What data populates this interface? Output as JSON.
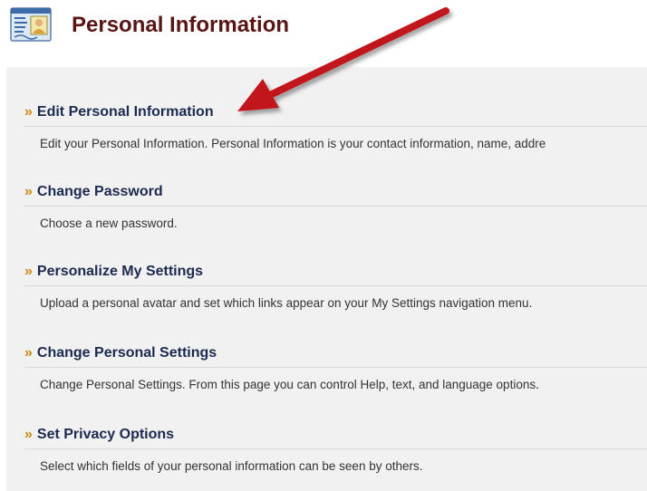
{
  "header": {
    "title": "Personal Information",
    "icon": "personal-info-card-icon"
  },
  "sections": [
    {
      "title": "Edit Personal Information",
      "description": "Edit your Personal Information. Personal Information is your contact information, name, addre"
    },
    {
      "title": "Change Password",
      "description": "Choose a new password."
    },
    {
      "title": "Personalize My Settings",
      "description": "Upload a personal avatar and set which links appear on your My Settings navigation menu."
    },
    {
      "title": "Change Personal Settings",
      "description": "Change Personal Settings. From this page you can control Help, text, and language options."
    },
    {
      "title": "Set Privacy Options",
      "description": "Select which fields of your personal information can be seen by others."
    }
  ],
  "chevron": "»",
  "colors": {
    "title": "#5a1414",
    "link": "#1c2a4f",
    "chevron": "#cf8a17",
    "panel": "#f1f1f1",
    "arrow": "#c0141b"
  }
}
